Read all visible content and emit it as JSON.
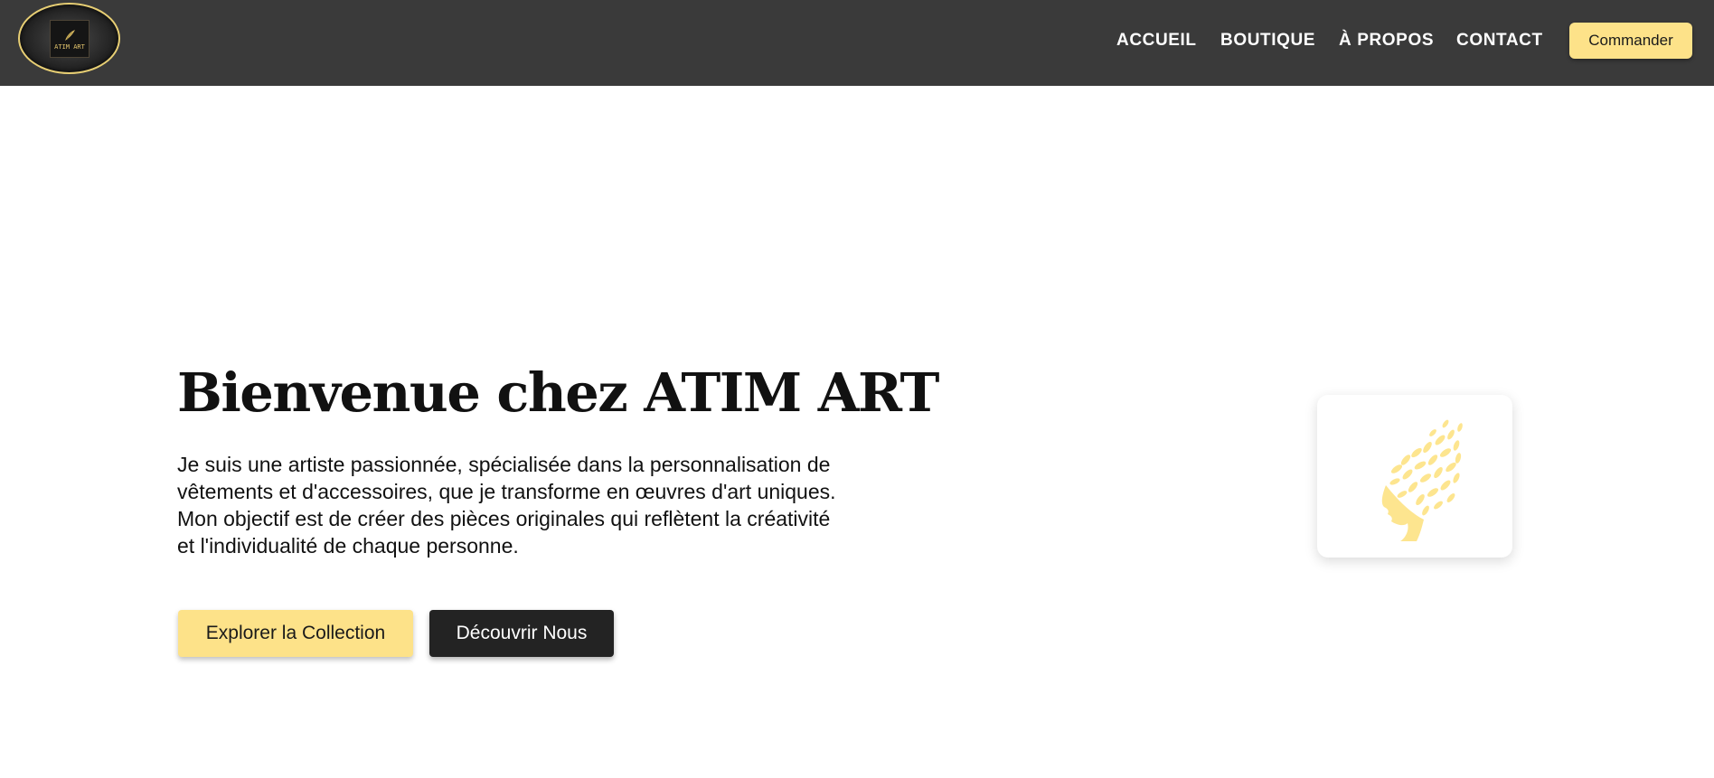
{
  "header": {
    "logo_text": "ATIM ART",
    "nav": [
      {
        "label": "ACCUEIL"
      },
      {
        "label": "BOUTIQUE"
      },
      {
        "label": "À PROPOS"
      },
      {
        "label": "CONTACT"
      }
    ],
    "order_button": "Commander"
  },
  "hero": {
    "title": "Bienvenue chez ATIM ART",
    "text": "Je suis une artiste passionnée, spécialisée dans la personnalisation de vêtements et d'accessoires, que je transforme en œuvres d'art uniques. Mon objectif est de créer des pièces originales qui reflètent la créativité et l'individualité de chaque personne.",
    "primary_button": "Explorer la Collection",
    "secondary_button": "Découvrir Nous",
    "image_icon": "leaf-head-icon"
  },
  "colors": {
    "header_bg": "#3a3a3a",
    "accent": "#fde289",
    "dark_button": "#232323",
    "text": "#111111"
  }
}
